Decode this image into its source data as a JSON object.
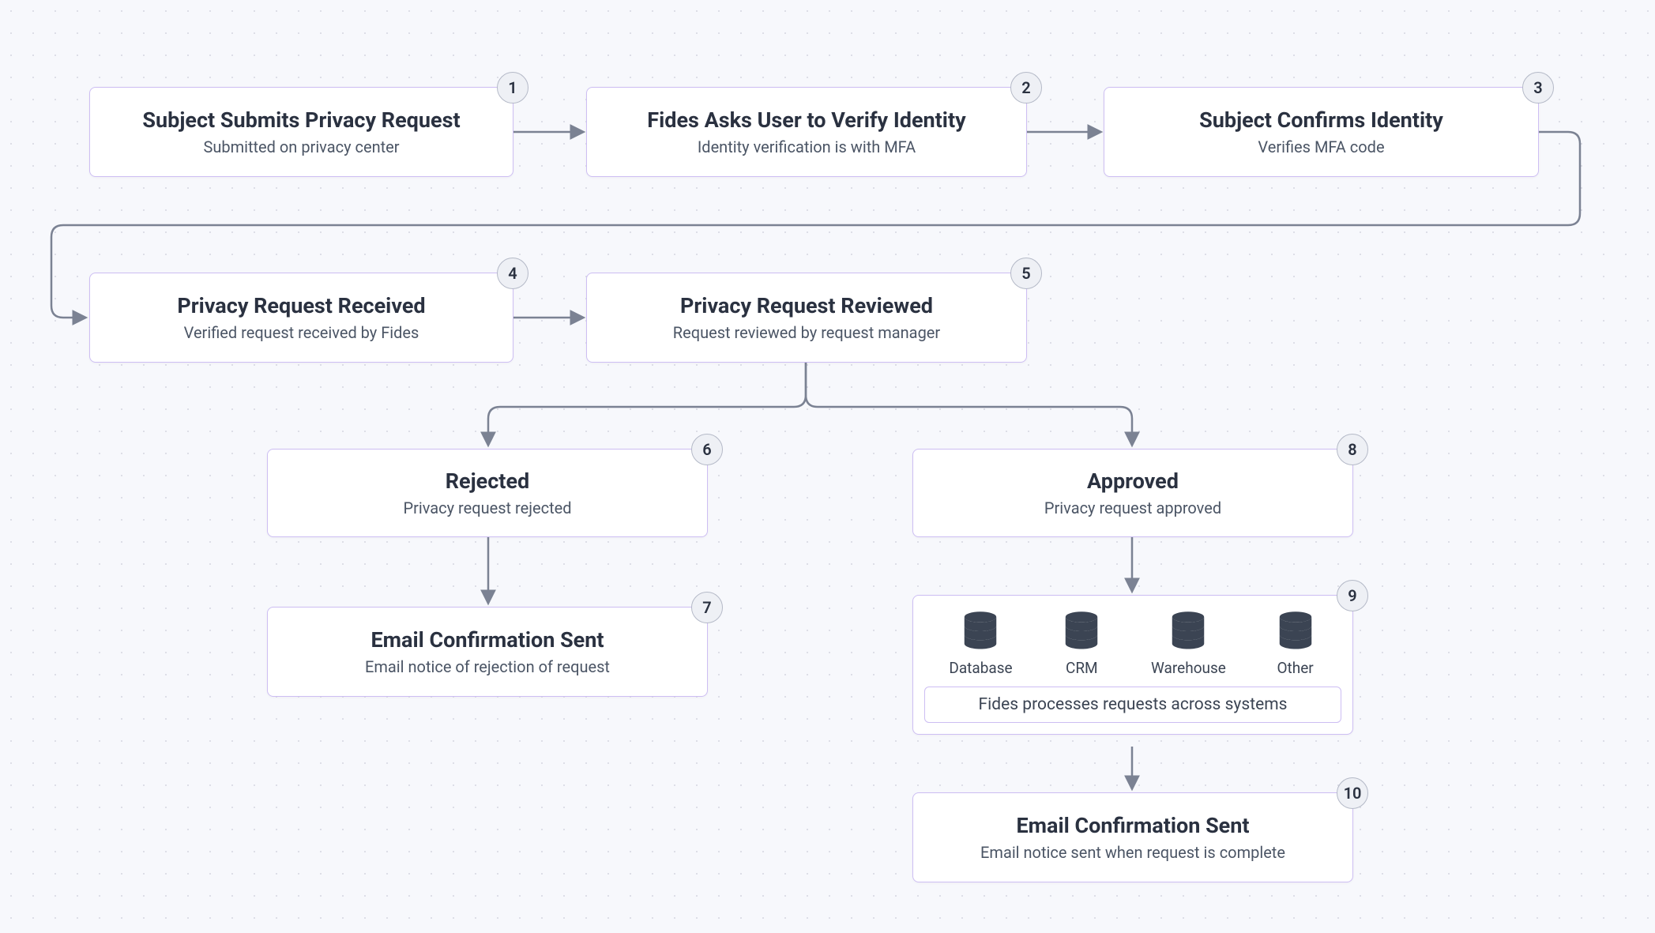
{
  "nodes": {
    "n1": {
      "num": "1",
      "title": "Subject Submits Privacy Request",
      "subtitle": "Submitted on privacy center"
    },
    "n2": {
      "num": "2",
      "title": "Fides Asks User to Verify Identity",
      "subtitle": "Identity verification is with MFA"
    },
    "n3": {
      "num": "3",
      "title": "Subject Confirms Identity",
      "subtitle": "Verifies MFA code"
    },
    "n4": {
      "num": "4",
      "title": "Privacy Request Received",
      "subtitle": "Verified request received by Fides"
    },
    "n5": {
      "num": "5",
      "title": "Privacy Request Reviewed",
      "subtitle": "Request reviewed by request manager"
    },
    "n6": {
      "num": "6",
      "title": "Rejected",
      "subtitle": "Privacy request rejected"
    },
    "n7": {
      "num": "7",
      "title": "Email Confirmation Sent",
      "subtitle": "Email notice of rejection of request"
    },
    "n8": {
      "num": "8",
      "title": "Approved",
      "subtitle": "Privacy request approved"
    },
    "n9": {
      "num": "9",
      "caption": "Fides processes requests across systems",
      "systems": [
        {
          "label": "Database"
        },
        {
          "label": "CRM"
        },
        {
          "label": "Warehouse"
        },
        {
          "label": "Other"
        }
      ]
    },
    "n10": {
      "num": "10",
      "title": "Email Confirmation Sent",
      "subtitle": "Email notice sent when request is complete"
    }
  },
  "colors": {
    "node_border": "#cdbef3",
    "badge_bg": "#eef0f5",
    "badge_border": "#b4b9c7",
    "arrow": "#7b8293",
    "title": "#2a3140",
    "subtitle": "#4b5565",
    "db_fill": "#3b4453"
  }
}
